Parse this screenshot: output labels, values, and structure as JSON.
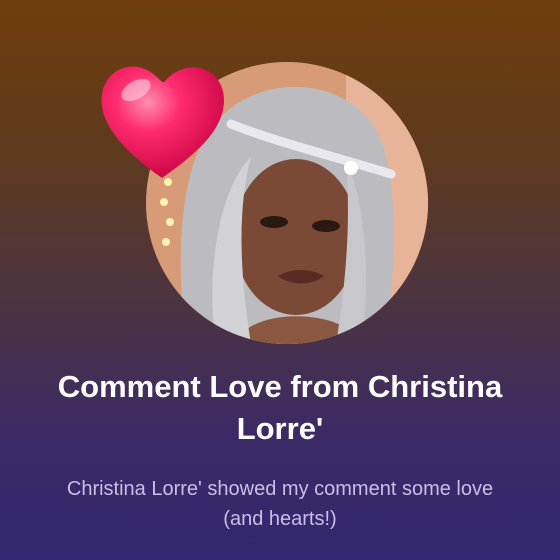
{
  "card": {
    "title": "Comment Love from Christina Lorre'",
    "subtitle": "Christina Lorre' showed my comment some love (and hearts!)"
  },
  "icons": {
    "heart": "heart-icon",
    "profile_photo": "avatar"
  },
  "colors": {
    "background_top": "#6f3d0c",
    "background_bottom": "#32276f",
    "heart": "#f0145a",
    "title_text": "#ffffff",
    "subtitle_text": "#cdbde6"
  }
}
